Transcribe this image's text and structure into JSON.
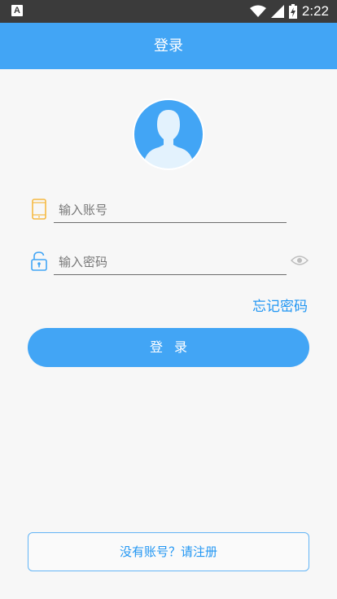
{
  "status_bar": {
    "left_icon_letter": "A",
    "time": "2:22",
    "icons": [
      "wifi-icon",
      "cell-signal-icon",
      "battery-charging-icon"
    ]
  },
  "header": {
    "title": "登录"
  },
  "avatar": {
    "icon": "default-user-avatar-icon",
    "bg_color": "#42a5f5",
    "silhouette_color": "#e3f2fd"
  },
  "form": {
    "account": {
      "placeholder": "输入账号",
      "value": "",
      "icon": "phone-icon",
      "icon_color": "#f5b942"
    },
    "password": {
      "placeholder": "输入密码",
      "value": "",
      "icon": "unlock-icon",
      "icon_color": "#42a5f5",
      "toggle_icon": "eye-icon"
    },
    "forgot_password": "忘记密码",
    "login_button": "登录"
  },
  "footer": {
    "register_button": "没有账号？请注册"
  },
  "colors": {
    "accent": "#42a5f5",
    "link": "#2196f3",
    "status_bar": "#3b3b3b",
    "background": "#f7f7f7"
  }
}
